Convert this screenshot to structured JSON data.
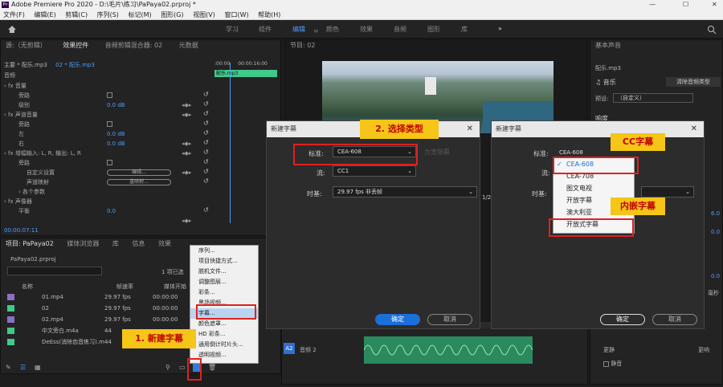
{
  "titlebar": {
    "title": "Adobe Premiere Pro 2020 - D:\\毛片\\练习\\PaPaya02.prproj *",
    "logo": "Pr"
  },
  "window_controls": [
    "—",
    "☐",
    "✕"
  ],
  "menu": [
    "文件(F)",
    "编辑(E)",
    "剪辑(C)",
    "序列(S)",
    "标记(M)",
    "图形(G)",
    "视图(V)",
    "窗口(W)",
    "帮助(H)"
  ],
  "workspaces": {
    "items": [
      "学习",
      "组件",
      "编辑",
      "颜色",
      "效果",
      "音频",
      "图形",
      "库"
    ],
    "active": "编辑",
    "more": "»"
  },
  "effect_controls": {
    "tabs": [
      "源:（无剪辑）",
      "效果控件",
      "音频剪辑混合器: 02",
      "元数据"
    ],
    "clip": "主要 * 配乐.mp3",
    "seq": "02 * 配乐.mp3",
    "time_start": ":00:00",
    "time_mid": "00:00:16:00",
    "time_end": "00:0",
    "clip_bar": "配乐.mp3",
    "section": "音频",
    "rows": [
      {
        "indent": 0,
        "label": "fx 音量",
        "value": ""
      },
      {
        "indent": 1,
        "label": "旁路",
        "value": "checkbox"
      },
      {
        "indent": 1,
        "label": "级别",
        "value": "0.0 dB"
      },
      {
        "indent": 0,
        "label": "fx 声道音量",
        "value": ""
      },
      {
        "indent": 1,
        "label": "旁路",
        "value": "checkbox"
      },
      {
        "indent": 1,
        "label": "左",
        "value": "0.0 dB"
      },
      {
        "indent": 1,
        "label": "右",
        "value": "0.0 dB"
      },
      {
        "indent": 0,
        "label": "fx 增幅输入: L, R, 输出: L, R",
        "value": ""
      },
      {
        "indent": 1,
        "label": "旁路",
        "value": "checkbox"
      },
      {
        "indent": 1,
        "label": "自定义设置",
        "value": "编辑..."
      },
      {
        "indent": 1,
        "label": "声道映射",
        "value": "重映射..."
      },
      {
        "indent": 1,
        "label": "各个参数",
        "value": ""
      },
      {
        "indent": 0,
        "label": "fx 声像器",
        "value": ""
      },
      {
        "indent": 1,
        "label": "平衡",
        "value": "0.0"
      }
    ],
    "timecode": "00:00:07:11"
  },
  "program_monitor": {
    "tab": "节目: 02",
    "fraction": "1/2"
  },
  "essential_sound": {
    "title": "基本声音",
    "clip": "配乐.mp3",
    "type": "音乐",
    "clear_btn": "清除音频类型",
    "preset_label": "预设:",
    "preset_value": "（自定义）",
    "loudness": "响度",
    "values": [
      "6.0",
      "0.0",
      "0.0",
      "毫秒"
    ],
    "foot_left": "更静",
    "foot_right": "更响",
    "mute": "静音"
  },
  "project": {
    "tabs": [
      "项目: PaPaya02",
      "媒体浏览器",
      "库",
      "信息",
      "效果"
    ],
    "file": "PaPaya02.prproj",
    "selected_info": "1 项已选",
    "columns": [
      "名称",
      "帧速率",
      "媒体开始"
    ],
    "items": [
      {
        "color": "#8a6fc7",
        "name": "01.mp4",
        "fps": "29.97 fps",
        "start": "00:00:00"
      },
      {
        "color": "#3fc98a",
        "name": "02",
        "fps": "29.97 fps",
        "start": "00:00:00"
      },
      {
        "color": "#8a6fc7",
        "name": "02.mp4",
        "fps": "29.97 fps",
        "start": "00:00:00"
      },
      {
        "color": "#3fc98a",
        "name": "中文旁白.m4a",
        "fps": "44",
        "start": ""
      },
      {
        "color": "#3fc98a",
        "name": "DeEss(消除齿音练习).m",
        "fps": "44",
        "start": ""
      }
    ]
  },
  "context_menu": [
    "序列...",
    "项目快捷方式...",
    "脱机文件...",
    "调整图层...",
    "彩条...",
    "黑场视频...",
    "字幕...",
    "颜色遮罩...",
    "HD 彩条...",
    "通用倒计时片头...",
    "透明视频..."
  ],
  "timeline": {
    "track": "A2",
    "track_name": "音频 2"
  },
  "dialog1": {
    "title": "新建字幕",
    "standard_label": "标准:",
    "standard_value": "CEA-608",
    "stream_label": "流:",
    "stream_value": "CC1",
    "timebase_label": "时基:",
    "timebase_value": "29.97 fps 非丢帧",
    "ok": "确定",
    "cancel": "取消",
    "ghost": "为宽银幕"
  },
  "dialog2": {
    "title": "新建字幕",
    "standard_label": "标准:",
    "standard_value": "CEA-608",
    "stream_label": "流:",
    "timebase_label": "时基:",
    "ok": "确定",
    "cancel": "取消",
    "options": [
      "CEA-608",
      "CEA-708",
      "图文电视",
      "开放字幕",
      "澳大利亚",
      "开放式字幕"
    ],
    "checked": "CEA-608"
  },
  "annotations": {
    "step1": "1. 新建字幕",
    "step2": "2. 选择类型",
    "cc": "CC字幕",
    "embedded": "内嵌字幕"
  }
}
